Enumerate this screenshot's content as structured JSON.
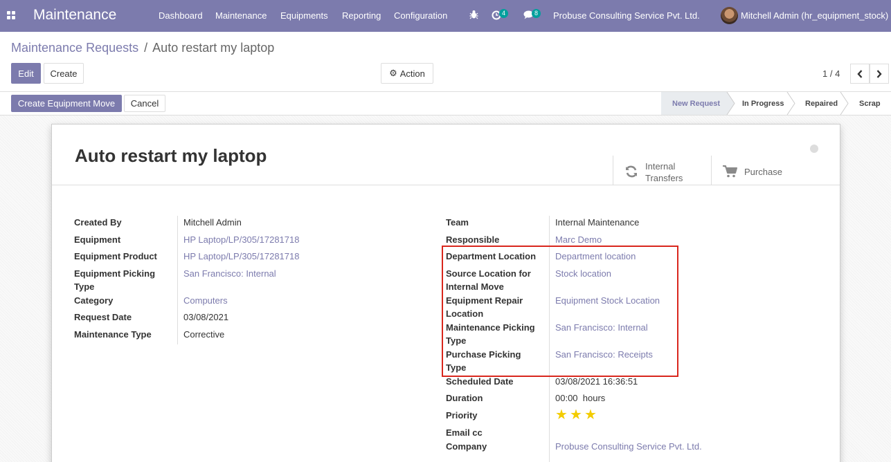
{
  "navbar": {
    "app_name": "Maintenance",
    "menu": [
      "Dashboard",
      "Maintenance",
      "Equipments",
      "Reporting",
      "Configuration"
    ],
    "activity_count": "4",
    "message_count": "8",
    "company": "Probuse Consulting Service Pvt. Ltd.",
    "user": "Mitchell Admin (hr_equipment_stock)"
  },
  "breadcrumb": {
    "parent": "Maintenance Requests",
    "separator": "/",
    "current": "Auto restart my laptop"
  },
  "buttons": {
    "edit": "Edit",
    "create": "Create",
    "action": "Action",
    "create_move": "Create Equipment Move",
    "cancel": "Cancel"
  },
  "pager": {
    "value": "1 / 4"
  },
  "stages": [
    "New Request",
    "In Progress",
    "Repaired",
    "Scrap"
  ],
  "record": {
    "title": "Auto restart my laptop",
    "smart_buttons": {
      "internal_line1": "Internal",
      "internal_line2": "Transfers",
      "purchase": "Purchase"
    },
    "left_fields": [
      {
        "label": "Created By",
        "value": "Mitchell Admin"
      },
      {
        "label": "Equipment",
        "value": "HP Laptop/LP/305/17281718"
      },
      {
        "label": "Equipment Product",
        "value": "HP Laptop/LP/305/17281718"
      },
      {
        "label": "Equipment Picking",
        "label2": "Type",
        "value": "San Francisco: Internal"
      },
      {
        "label": "Category",
        "value": "Computers"
      },
      {
        "label": "Request Date",
        "value": "03/08/2021"
      },
      {
        "label": "Maintenance Type",
        "value": "Corrective"
      }
    ],
    "right_fields": [
      {
        "label": "Team",
        "value": "Internal Maintenance"
      },
      {
        "label": "Responsible",
        "value": "Marc Demo"
      },
      {
        "label": "Department Location",
        "value": "Department location"
      },
      {
        "label": "Source Location for",
        "label2": "Internal Move",
        "value": "Stock location"
      },
      {
        "label": "Equipment Repair",
        "label2": "Location",
        "value": "Equipment Stock Location"
      },
      {
        "label": "Maintenance Picking",
        "label2": "Type",
        "value": "San Francisco: Internal"
      },
      {
        "label": "Purchase Picking",
        "label2": "Type",
        "value": "San Francisco: Receipts"
      },
      {
        "label": "Scheduled Date",
        "value": "03/08/2021 16:36:51"
      },
      {
        "label": "Duration",
        "value": "00:00  hours"
      },
      {
        "label": "Priority",
        "value": 3,
        "max": 3
      },
      {
        "label": "Email cc",
        "value": ""
      },
      {
        "label": "Company",
        "value": "Probuse Consulting Service Pvt. Ltd."
      }
    ]
  },
  "colors": {
    "brand": "#7c7bad",
    "highlight_box": "#d9261c",
    "star": "#f3cc00"
  }
}
